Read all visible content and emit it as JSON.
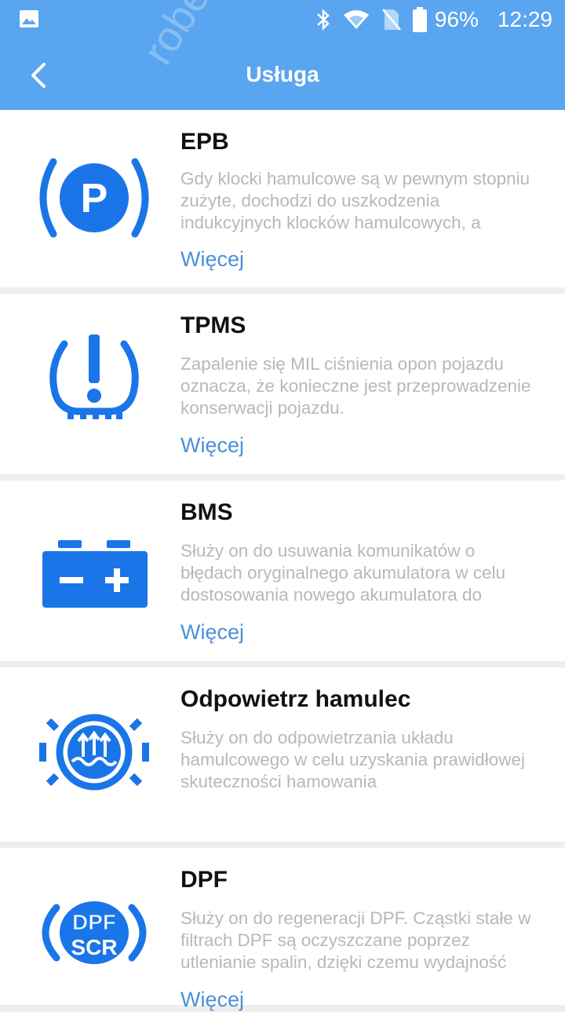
{
  "status_bar": {
    "battery_percent": "96%",
    "time": "12:29",
    "icons": [
      "gallery-icon",
      "bluetooth-icon",
      "wifi-icon",
      "no-sim-icon",
      "battery-icon"
    ]
  },
  "header": {
    "title": "Usługa",
    "watermark": "robert"
  },
  "colors": {
    "accent": "#5aa5ef",
    "icon_blue": "#1a75e8",
    "link": "#4a90d9"
  },
  "services": [
    {
      "name": "EPB",
      "description": "Gdy klocki hamulcowe są w pewnym stopniu zużyte, dochodzi do uszkodzenia indukcyjnych klocków hamulcowych, a",
      "more": "Więcej",
      "icon": "parking-brake-icon"
    },
    {
      "name": "TPMS",
      "description": "Zapalenie się MIL ciśnienia opon pojazdu oznacza, że konieczne jest przeprowadzenie konserwacji pojazdu.",
      "more": "Więcej",
      "icon": "tire-pressure-icon"
    },
    {
      "name": "BMS",
      "description": "Służy on do usuwania komunikatów o błędach oryginalnego akumulatora w celu dostosowania nowego akumulatora do",
      "more": "Więcej",
      "icon": "battery-icon"
    },
    {
      "name": "Odpowietrz hamulec",
      "description": "Służy on do odpowietrzania układu hamulcowego w celu uzyskania prawidłowej skuteczności hamowania",
      "more": "",
      "icon": "brake-bleed-icon"
    },
    {
      "name": "DPF",
      "description": "Służy on do regeneracji DPF. Cząstki stałe w filtrach DPF są oczyszczane poprzez utlenianie spalin, dzięki czemu wydajność",
      "more": "Więcej",
      "icon": "dpf-scr-icon",
      "icon_text": [
        "DPF",
        "SCR"
      ]
    }
  ]
}
